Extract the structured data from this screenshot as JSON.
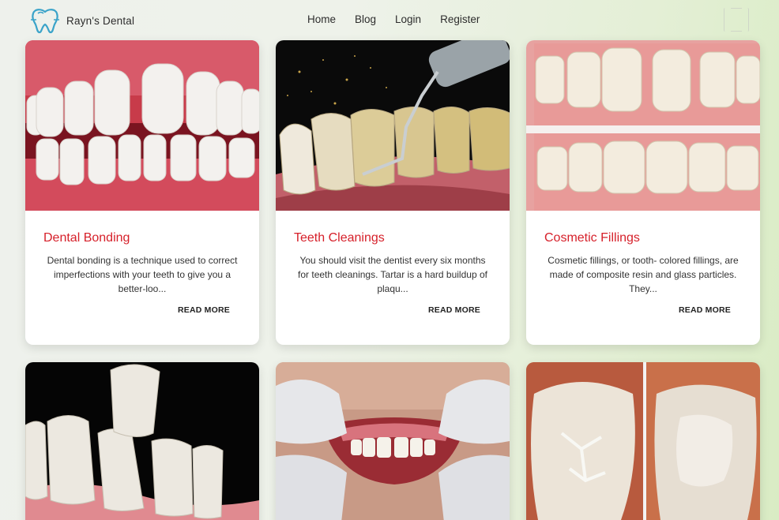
{
  "header": {
    "brand": "Rayn's Dental",
    "nav": [
      "Home",
      "Blog",
      "Login",
      "Register"
    ]
  },
  "cards": [
    {
      "title": "Dental Bonding",
      "description": "Dental bonding is a technique used to correct imperfections with your teeth to give you a better-loo...",
      "more": "READ MORE"
    },
    {
      "title": "Teeth Cleanings",
      "description": "You should visit the dentist every six months for teeth cleanings. Tartar is a hard buildup of plaqu...",
      "more": "READ MORE"
    },
    {
      "title": "Cosmetic Fillings",
      "description": "Cosmetic fillings, or tooth- colored fillings, are made of composite resin and glass particles. They...",
      "more": "READ MORE"
    }
  ],
  "colors": {
    "accent": "#d6202a",
    "logo": "#3aa3c9"
  }
}
